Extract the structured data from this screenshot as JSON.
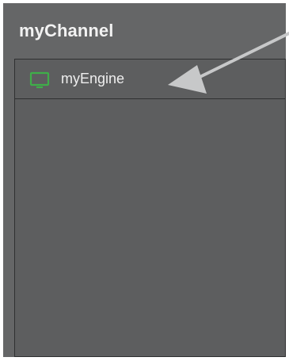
{
  "channel": {
    "title": "myChannel"
  },
  "engines": [
    {
      "label": "myEngine",
      "icon": "monitor-icon"
    }
  ],
  "colors": {
    "background": "#656667",
    "panel": "#5d5e5f",
    "border": "#2f3031",
    "text": "#eeeeee",
    "icon": "#3fae49",
    "arrow": "#c7c8c9"
  }
}
